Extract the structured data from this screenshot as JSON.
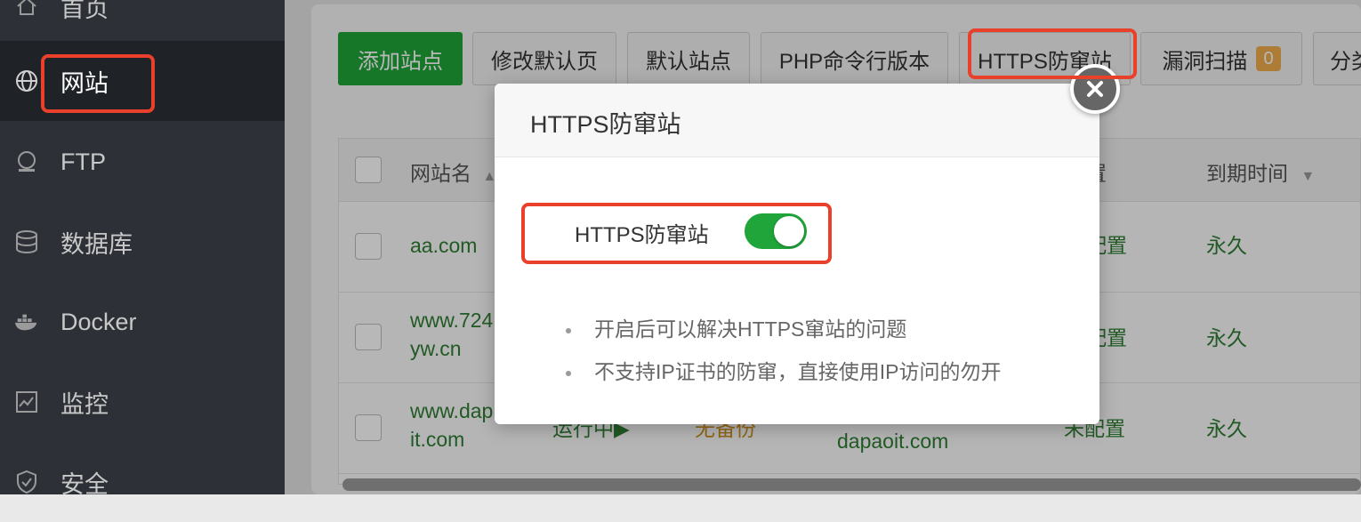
{
  "sidebar": {
    "items": [
      {
        "label": "首页",
        "icon": "home-icon"
      },
      {
        "label": "网站",
        "icon": "globe-icon"
      },
      {
        "label": "FTP",
        "icon": "ftp-icon"
      },
      {
        "label": "数据库",
        "icon": "database-icon"
      },
      {
        "label": "Docker",
        "icon": "docker-icon"
      },
      {
        "label": "监控",
        "icon": "monitor-icon"
      },
      {
        "label": "安全",
        "icon": "shield-icon"
      }
    ]
  },
  "toolbar": {
    "add_site": "添加站点",
    "edit_default_page": "修改默认页",
    "default_site": "默认站点",
    "php_cli_version": "PHP命令行版本",
    "https_anti_cross": "HTTPS防窜站",
    "vuln_scan": "漏洞扫描",
    "vuln_count": "0",
    "category": "分类"
  },
  "table": {
    "headers": {
      "site_name": "网站名",
      "ssl_config": "置",
      "expire": "到期时间"
    },
    "rows": [
      {
        "name_line1": "aa.com",
        "name_line2": "",
        "ssl": "配置",
        "expire": "永久"
      },
      {
        "name_line1": "www.724",
        "name_line2": "yw.cn",
        "ssl": "配置",
        "expire": "永久"
      },
      {
        "name_line1": "www.dap",
        "name_line2": "it.com",
        "status": "运行中▶",
        "backup": "无备份",
        "domain": "dapaoit.com",
        "ssl": "未配置",
        "expire": "永久"
      }
    ]
  },
  "modal": {
    "title": "HTTPS防窜站",
    "toggle_label": "HTTPS防窜站",
    "toggle_on": true,
    "notes": [
      "开启后可以解决HTTPS窜站的问题",
      "不支持IP证书的防窜，直接使用IP访问的勿开"
    ]
  },
  "colors": {
    "accent": "#20a53a",
    "highlight": "#e8402a",
    "sidebar_bg": "#2d3137"
  }
}
